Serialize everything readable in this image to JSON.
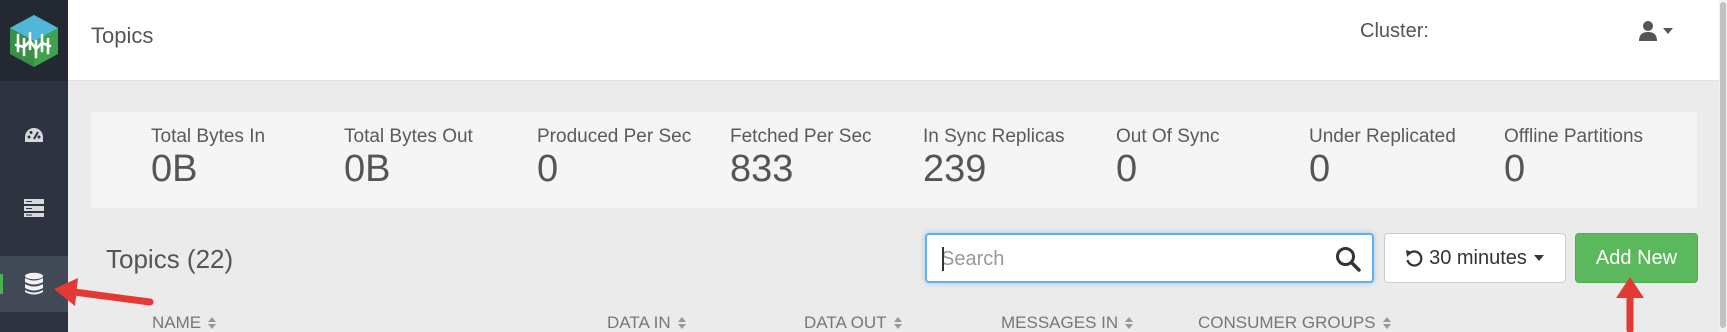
{
  "header": {
    "title": "Topics",
    "cluster_label": "Cluster:"
  },
  "sidebar": {
    "items": [
      {
        "icon": "dashboard-icon"
      },
      {
        "icon": "server-icon"
      },
      {
        "icon": "database-icon",
        "active": true
      }
    ]
  },
  "stats": [
    {
      "label": "Total Bytes In",
      "value": "0B"
    },
    {
      "label": "Total Bytes Out",
      "value": "0B"
    },
    {
      "label": "Produced Per Sec",
      "value": "0"
    },
    {
      "label": "Fetched Per Sec",
      "value": "833"
    },
    {
      "label": "In Sync Replicas",
      "value": "239"
    },
    {
      "label": "Out Of Sync",
      "value": "0"
    },
    {
      "label": "Under Replicated",
      "value": "0"
    },
    {
      "label": "Offline Partitions",
      "value": "0"
    }
  ],
  "topics": {
    "heading": "Topics (22)",
    "search_placeholder": "Search",
    "time_range": "30 minutes",
    "add_button": "Add New",
    "columns": [
      "NAME",
      "DATA IN",
      "DATA OUT",
      "MESSAGES IN",
      "CONSUMER GROUPS"
    ]
  },
  "colors": {
    "accent_green": "#5cb85c",
    "sidebar": "#2d3340",
    "annotation_red": "#e53935"
  }
}
